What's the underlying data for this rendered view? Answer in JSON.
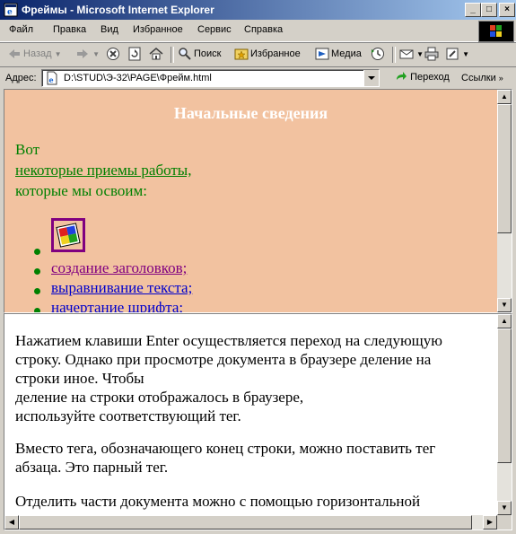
{
  "window": {
    "title": "Фреймы - Microsoft Internet Explorer",
    "controls": {
      "minimize": "_",
      "maximize": "□",
      "close": "×"
    }
  },
  "menu": [
    "Файл",
    "Правка",
    "Вид",
    "Избранное",
    "Сервис",
    "Справка"
  ],
  "toolbar": {
    "back": "Назад",
    "search": "Поиск",
    "favorites": "Избранное",
    "media": "Медиа"
  },
  "address": {
    "label": "Адрес:",
    "value": "D:\\STUD\\Э-32\\PAGE\\Фрейм.html",
    "go": "Переход",
    "links": "Ссылки"
  },
  "top_frame": {
    "heading": "Начальные сведения",
    "intro_1": "Вот",
    "intro_link": "некоторые приемы работы,",
    "intro_2": "которые мы освоим:",
    "list": [
      {
        "label": "создание заголовков;",
        "color": "#800080"
      },
      {
        "label": "выравнивание текста;",
        "color": "#0000cc"
      },
      {
        "label": "начертание шрифта;",
        "color": "#0000cc"
      }
    ],
    "background": "#f2c2a0",
    "text_color": "#008000"
  },
  "bottom_frame": {
    "lines": [
      "Нажатием клавиши Enter осуществляется переход на следующую",
      "строку. Однако при просмотре документа в браузере деление на",
      "строки иное. Чтобы",
      "деление на строки отображалось в браузере,",
      "используйте соответствующий тег.",
      "",
      "Вместо тега, обозначающего конец строки, можно поставить тег",
      "абзаца. Это парный тег.",
      "",
      "Отделить части документа можно с помощью горизонтальной"
    ]
  },
  "colors": {
    "titlebar_start": "#0a246a",
    "titlebar_end": "#a6caf0",
    "chrome": "#d4d0c8"
  }
}
